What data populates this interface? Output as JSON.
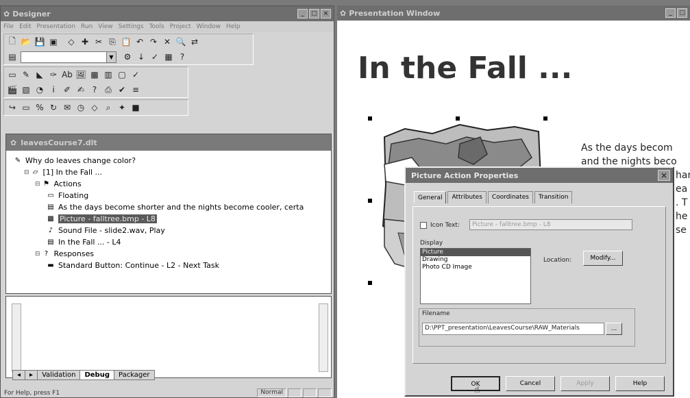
{
  "designer": {
    "title": "Designer",
    "menu": [
      "File",
      "Edit",
      "Presentation",
      "Run",
      "View",
      "Settings",
      "Tools",
      "Project",
      "Window",
      "Help"
    ],
    "tree_title": "leavesCourse7.dlt",
    "tree": [
      {
        "label": "Why do leaves change color?",
        "indent": 0,
        "icon": "course-icon"
      },
      {
        "label": "[1] In the Fall ...",
        "indent": 1,
        "icon": "slide-icon"
      },
      {
        "label": "Actions",
        "indent": 2,
        "icon": "actions-icon"
      },
      {
        "label": "Floating",
        "indent": 3,
        "icon": "window-icon"
      },
      {
        "label": "As the days become shorter and the nights become cooler, certa",
        "indent": 3,
        "icon": "text-icon"
      },
      {
        "label": "Picture - falltree.bmp - L8",
        "indent": 3,
        "icon": "picture-icon",
        "selected": true
      },
      {
        "label": "Sound File - slide2.wav, Play",
        "indent": 3,
        "icon": "sound-icon"
      },
      {
        "label": "In the Fall ... - L4",
        "indent": 3,
        "icon": "text-icon"
      },
      {
        "label": "Responses",
        "indent": 2,
        "icon": "question-icon"
      },
      {
        "label": "Standard Button: Continue - L2 - Next Task",
        "indent": 3,
        "icon": "button-icon"
      }
    ],
    "tabs": [
      "Validation",
      "Debug",
      "Packager"
    ],
    "active_tab": "Debug",
    "status": "For Help, press F1",
    "status_mode": "Normal"
  },
  "presentation": {
    "title": "Presentation Window",
    "slide_title": "In the Fall ...",
    "slide_text": [
      "As the days becom",
      "and the nights beco",
      "han",
      "ea",
      ". T",
      "he",
      "se"
    ]
  },
  "dialog": {
    "title": "Picture Action Properties",
    "tabs": [
      "General",
      "Attributes",
      "Coordinates",
      "Transition"
    ],
    "active_tab": "General",
    "icon_text_label": "Icon Text:",
    "icon_text_value": "Picture - falltree.bmp - L8",
    "display_label": "Display",
    "display_options": [
      "Picture",
      "Drawing",
      "Photo CD Image"
    ],
    "display_selected": "Picture",
    "location_label": "Location:",
    "modify_label": "Modify...",
    "filename_label": "Filename",
    "filename_value": "D:\\PPT_presentation\\LeavesCourse\\RAW_Materials",
    "browse_label": "...",
    "ok_label": "OK",
    "cancel_label": "Cancel",
    "apply_label": "Apply",
    "help_label": "Help"
  },
  "colors": {
    "titlebar": "#6e6e6e",
    "window_bg": "#d4d4d4",
    "selection": "#5a5a5a"
  }
}
